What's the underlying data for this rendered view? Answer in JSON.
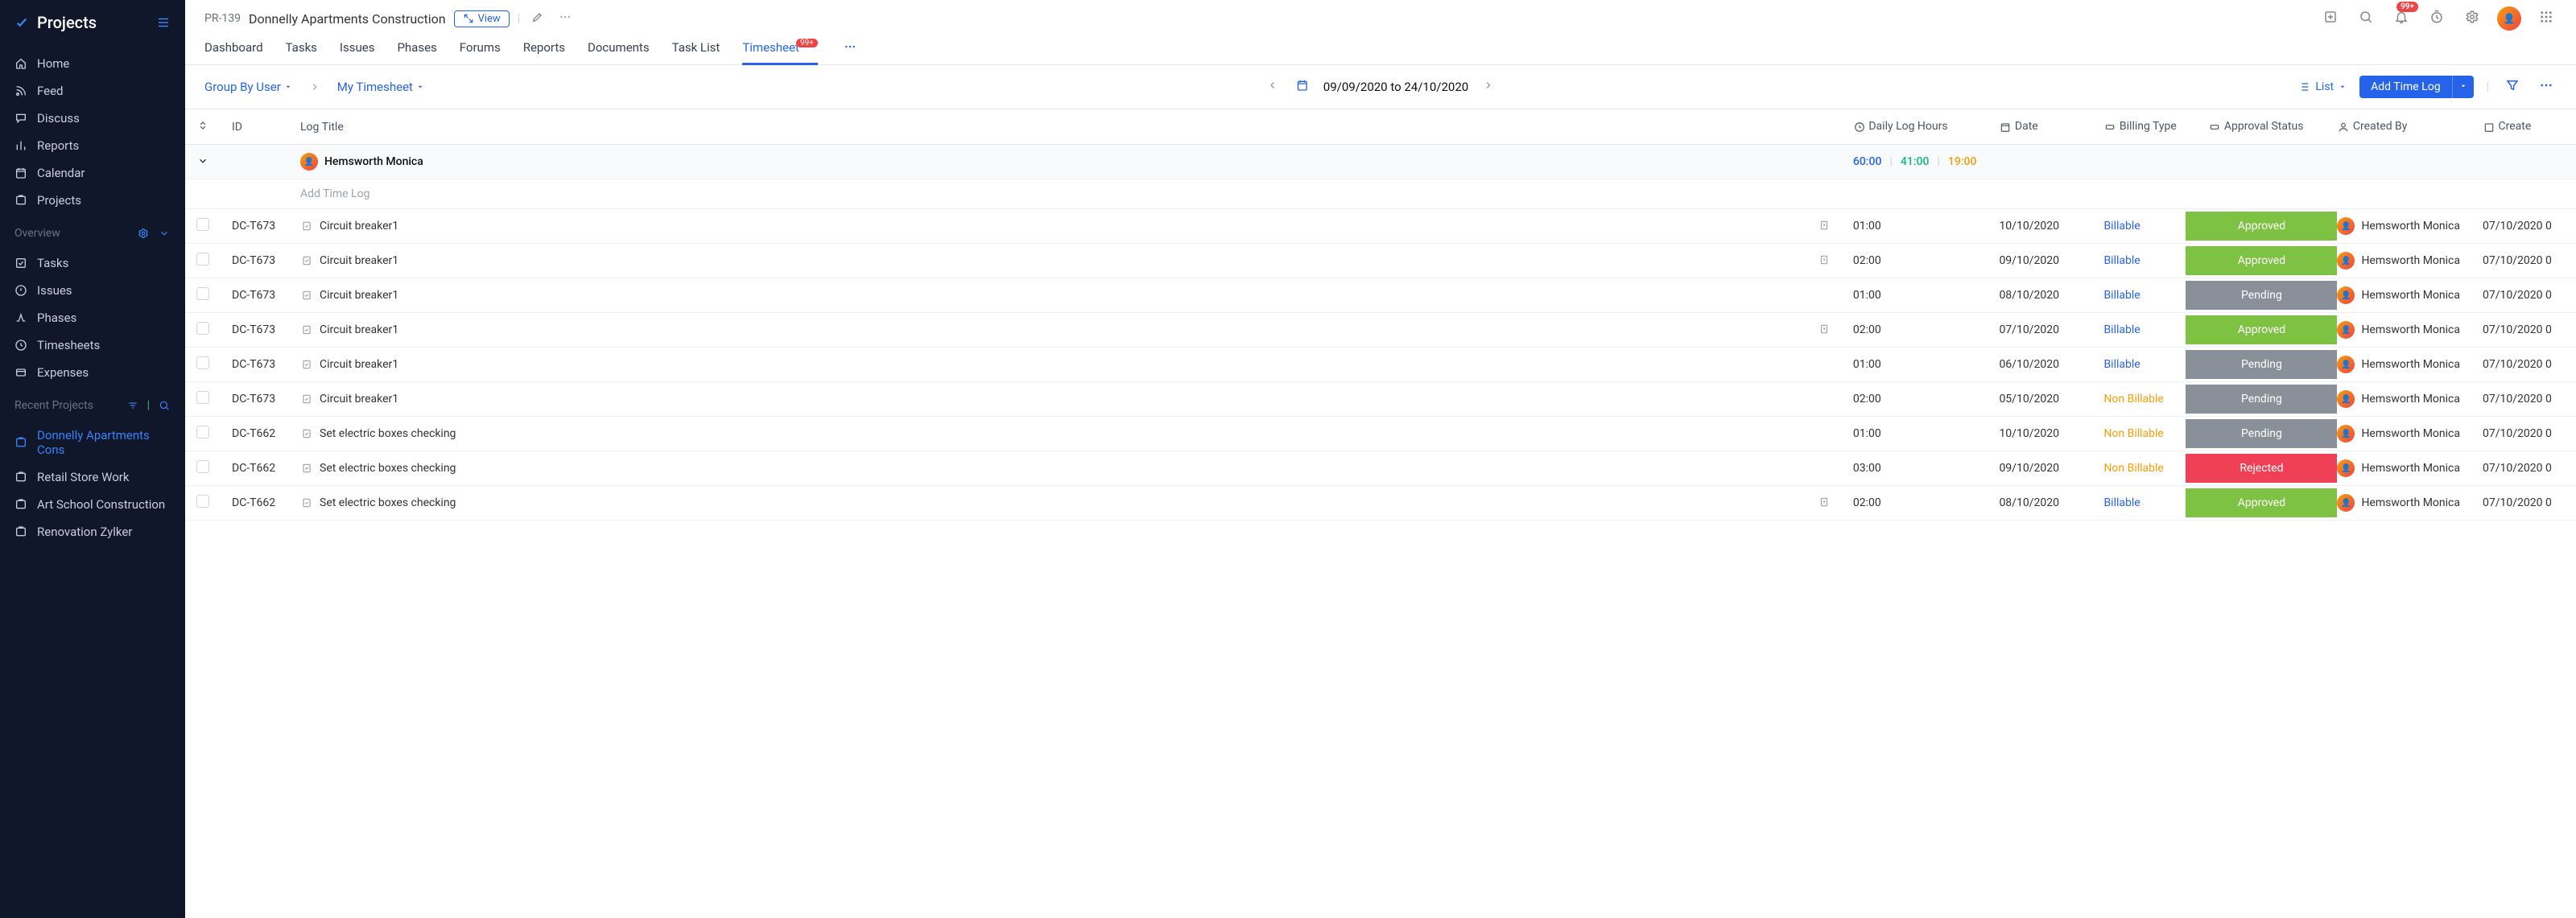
{
  "brand": "Projects",
  "sidebar": {
    "main": [
      {
        "label": "Home",
        "icon": "home"
      },
      {
        "label": "Feed",
        "icon": "feed"
      },
      {
        "label": "Discuss",
        "icon": "discuss"
      },
      {
        "label": "Reports",
        "icon": "reports"
      },
      {
        "label": "Calendar",
        "icon": "calendar"
      },
      {
        "label": "Projects",
        "icon": "projects"
      }
    ],
    "overview_label": "Overview",
    "overview": [
      {
        "label": "Tasks",
        "icon": "tasks"
      },
      {
        "label": "Issues",
        "icon": "issues"
      },
      {
        "label": "Phases",
        "icon": "phases"
      },
      {
        "label": "Timesheets",
        "icon": "timesheets"
      },
      {
        "label": "Expenses",
        "icon": "expenses"
      }
    ],
    "recent_label": "Recent Projects",
    "recent": [
      {
        "label": "Donnelly Apartments Cons",
        "active": true
      },
      {
        "label": "Retail Store Work"
      },
      {
        "label": "Art School Construction"
      },
      {
        "label": "Renovation Zylker"
      }
    ]
  },
  "header": {
    "code": "PR-139",
    "name": "Donnelly Apartments Construction",
    "view_btn": "View",
    "bell_badge": "99+"
  },
  "tabs": {
    "items": [
      "Dashboard",
      "Tasks",
      "Issues",
      "Phases",
      "Forums",
      "Reports",
      "Documents",
      "Task List",
      "Timesheet"
    ],
    "active": "Timesheet",
    "timesheet_badge": "99+"
  },
  "filter": {
    "group_by": "Group By User",
    "scope": "My Timesheet",
    "date_range": "09/09/2020 to 24/10/2020",
    "list_label": "List",
    "add_btn": "Add Time Log"
  },
  "table": {
    "columns": [
      "ID",
      "Log Title",
      "Daily Log Hours",
      "Date",
      "Billing Type",
      "Approval Status",
      "Created By",
      "Create"
    ],
    "group": {
      "user": "Hemsworth Monica",
      "total": "60:00",
      "approved": "41:00",
      "other": "19:00"
    },
    "add_row_label": "Add Time Log",
    "rows": [
      {
        "id": "DC-T673",
        "title": "Circuit breaker1",
        "hours": "01:00",
        "date": "10/10/2020",
        "billing": "Billable",
        "status": "Approved",
        "creator": "Hemsworth Monica",
        "created": "07/10/2020 0",
        "note": true
      },
      {
        "id": "DC-T673",
        "title": "Circuit breaker1",
        "hours": "02:00",
        "date": "09/10/2020",
        "billing": "Billable",
        "status": "Approved",
        "creator": "Hemsworth Monica",
        "created": "07/10/2020 0",
        "note": true
      },
      {
        "id": "DC-T673",
        "title": "Circuit breaker1",
        "hours": "01:00",
        "date": "08/10/2020",
        "billing": "Billable",
        "status": "Pending",
        "creator": "Hemsworth Monica",
        "created": "07/10/2020 0"
      },
      {
        "id": "DC-T673",
        "title": "Circuit breaker1",
        "hours": "02:00",
        "date": "07/10/2020",
        "billing": "Billable",
        "status": "Approved",
        "creator": "Hemsworth Monica",
        "created": "07/10/2020 0",
        "note": true
      },
      {
        "id": "DC-T673",
        "title": "Circuit breaker1",
        "hours": "01:00",
        "date": "06/10/2020",
        "billing": "Billable",
        "status": "Pending",
        "creator": "Hemsworth Monica",
        "created": "07/10/2020 0"
      },
      {
        "id": "DC-T673",
        "title": "Circuit breaker1",
        "hours": "02:00",
        "date": "05/10/2020",
        "billing": "Non Billable",
        "status": "Pending",
        "creator": "Hemsworth Monica",
        "created": "07/10/2020 0"
      },
      {
        "id": "DC-T662",
        "title": "Set electric boxes checking",
        "hours": "01:00",
        "date": "10/10/2020",
        "billing": "Non Billable",
        "status": "Pending",
        "creator": "Hemsworth Monica",
        "created": "07/10/2020 0"
      },
      {
        "id": "DC-T662",
        "title": "Set electric boxes checking",
        "hours": "03:00",
        "date": "09/10/2020",
        "billing": "Non Billable",
        "status": "Rejected",
        "creator": "Hemsworth Monica",
        "created": "07/10/2020 0"
      },
      {
        "id": "DC-T662",
        "title": "Set electric boxes checking",
        "hours": "02:00",
        "date": "08/10/2020",
        "billing": "Billable",
        "status": "Approved",
        "creator": "Hemsworth Monica",
        "created": "07/10/2020 0",
        "note": true
      }
    ]
  }
}
